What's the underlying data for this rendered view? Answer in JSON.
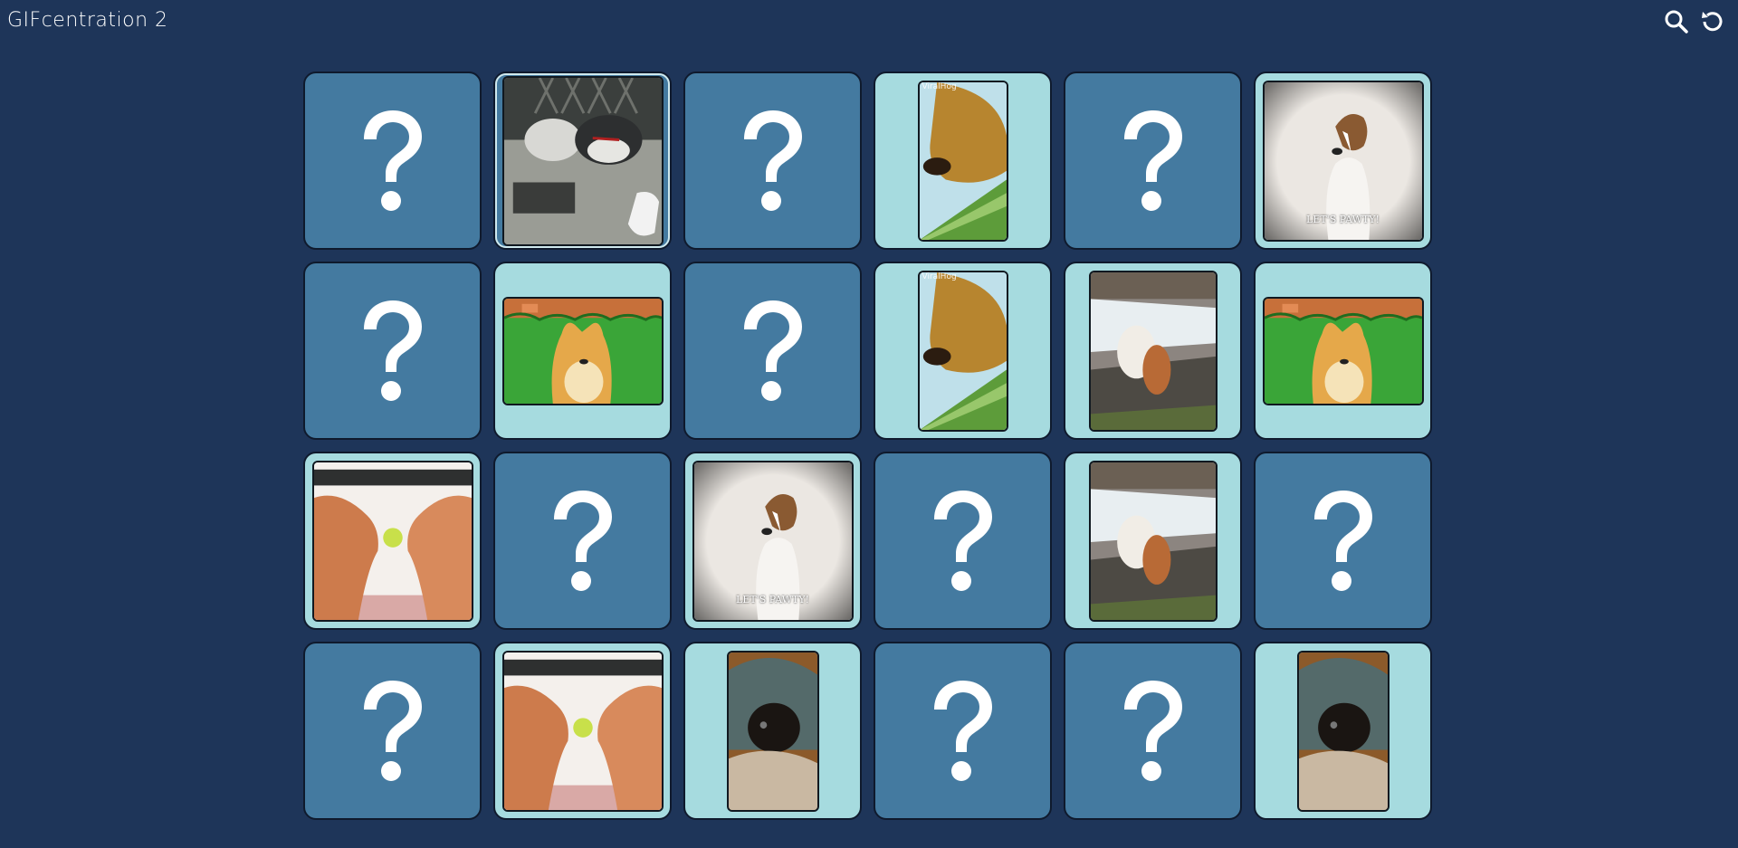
{
  "app": {
    "title": "GIFcentration 2"
  },
  "toolbar": {
    "search_icon": "search-icon",
    "restart_icon": "restart-icon"
  },
  "colors": {
    "background": "#1e3559",
    "card_hidden": "#447aa0",
    "card_revealed": "#a6dbdf"
  },
  "pictures": {
    "jack": {
      "caption": "LET'S PAWTY!"
    },
    "golden": {
      "watermark": "ViralHog"
    }
  },
  "cards": [
    {
      "state": "hidden"
    },
    {
      "state": "selected",
      "picture": "husky"
    },
    {
      "state": "hidden"
    },
    {
      "state": "revealed",
      "picture": "golden"
    },
    {
      "state": "hidden"
    },
    {
      "state": "revealed",
      "picture": "jack"
    },
    {
      "state": "hidden"
    },
    {
      "state": "revealed",
      "picture": "doge"
    },
    {
      "state": "hidden"
    },
    {
      "state": "revealed",
      "picture": "golden"
    },
    {
      "state": "revealed",
      "picture": "river"
    },
    {
      "state": "revealed",
      "picture": "doge"
    },
    {
      "state": "revealed",
      "picture": "retrievers"
    },
    {
      "state": "hidden"
    },
    {
      "state": "revealed",
      "picture": "jack"
    },
    {
      "state": "hidden"
    },
    {
      "state": "revealed",
      "picture": "river"
    },
    {
      "state": "hidden"
    },
    {
      "state": "hidden"
    },
    {
      "state": "revealed",
      "picture": "retrievers"
    },
    {
      "state": "revealed",
      "picture": "hooded"
    },
    {
      "state": "hidden"
    },
    {
      "state": "hidden"
    },
    {
      "state": "revealed",
      "picture": "hooded"
    }
  ]
}
